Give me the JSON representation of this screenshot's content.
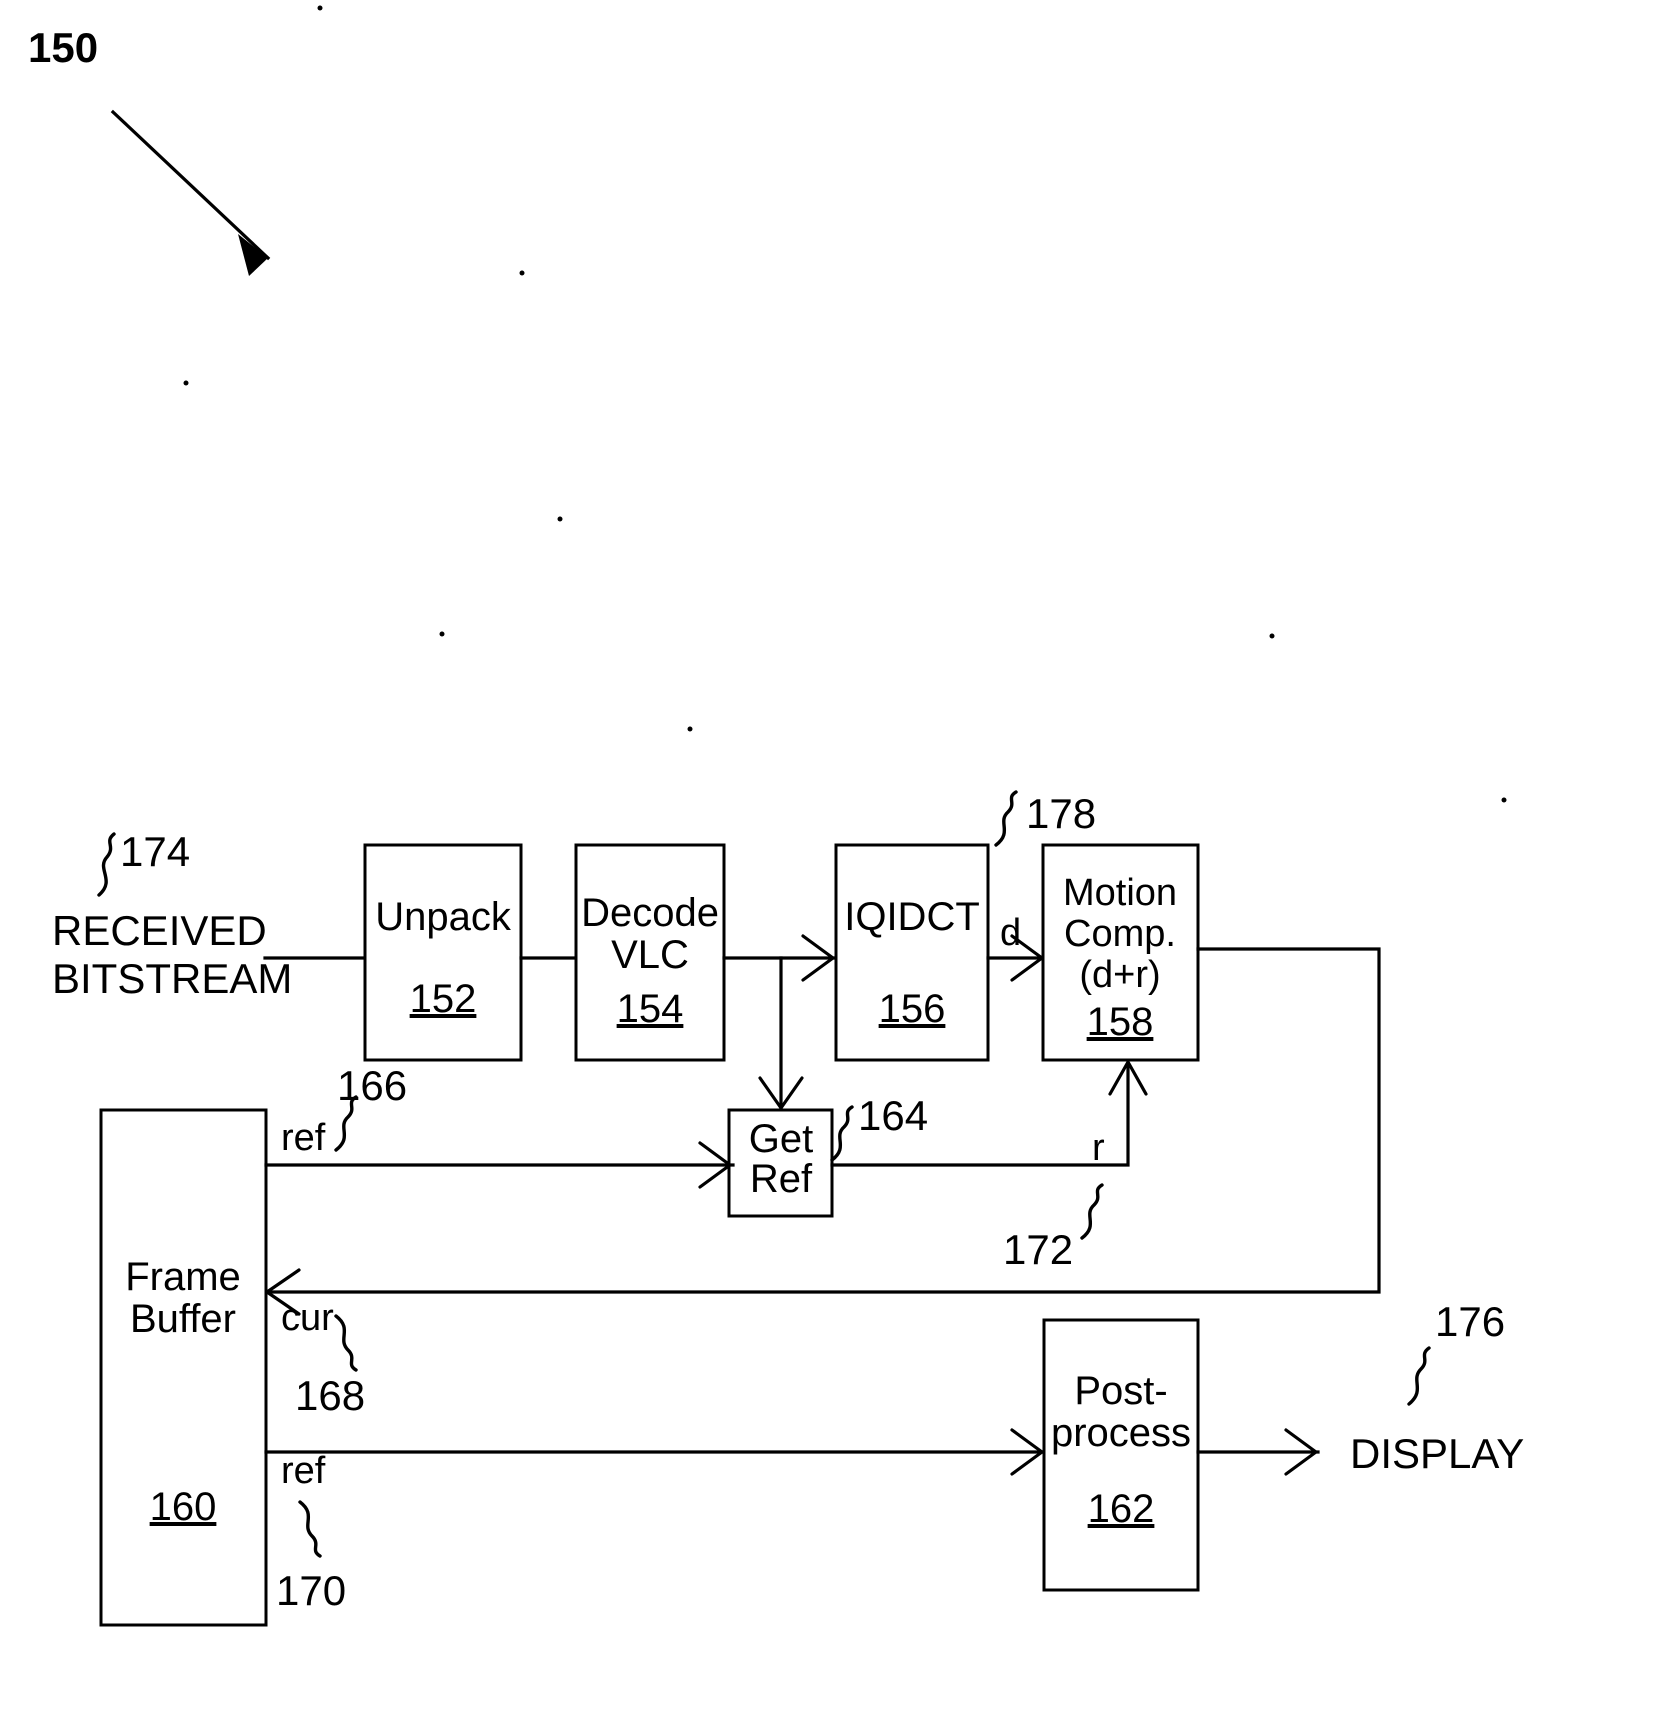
{
  "figure": {
    "id_label": "150",
    "pointer_arrow": "diagonal-arrow"
  },
  "blocks": [
    {
      "key": "unpack",
      "line1": "Unpack",
      "line2": "",
      "line3": "",
      "ref": "152"
    },
    {
      "key": "decode_vlc",
      "line1": "Decode",
      "line2": "VLC",
      "line3": "",
      "ref": "154"
    },
    {
      "key": "iqidct",
      "line1": "IQIDCT",
      "line2": "",
      "line3": "",
      "ref": "156"
    },
    {
      "key": "motion_comp",
      "line1": "Motion",
      "line2": "Comp.",
      "line3": "(d+r)",
      "ref": "158"
    },
    {
      "key": "frame_buffer",
      "line1": "Frame",
      "line2": "Buffer",
      "line3": "",
      "ref": "160"
    },
    {
      "key": "post_process",
      "line1": "Post-",
      "line2": "process",
      "line3": "",
      "ref": "162"
    },
    {
      "key": "get_ref",
      "line1": "Get",
      "line2": "Ref",
      "line3": "",
      "ref": ""
    }
  ],
  "io": {
    "input_line1": "RECEIVED",
    "input_line2": "BITSTREAM",
    "input_ref": "174",
    "output_label": "DISPLAY",
    "output_ref": "176"
  },
  "signals": {
    "ref_top": "ref",
    "ref_top_num": "166",
    "cur": "cur",
    "cur_num": "168",
    "ref_bottom": "ref",
    "ref_bottom_num": "170",
    "get_ref_num": "164",
    "r": "r",
    "r_num": "172",
    "d": "d",
    "d_num": "178"
  }
}
